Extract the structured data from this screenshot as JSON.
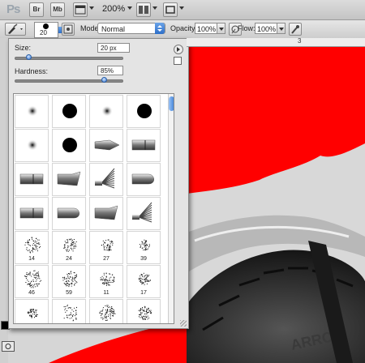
{
  "app": {
    "logo": "Ps",
    "bridge_label": "Br",
    "minibridge_label": "Mb",
    "zoom": "200%"
  },
  "options": {
    "brush_size": "20",
    "mode_label": "Mode:",
    "mode_value": "Normal",
    "opacity_label": "Opacity:",
    "opacity_value": "100%",
    "flow_label": "Flow:",
    "flow_value": "100%"
  },
  "ruler": {
    "mark": "3"
  },
  "brush_panel": {
    "size_label": "Size:",
    "size_value": "20 px",
    "size_level": 0.1,
    "hardness_label": "Hardness:",
    "hardness_value": "85%",
    "hardness_level": 0.85,
    "presets": [
      {
        "kind": "soft-round",
        "sz": ""
      },
      {
        "kind": "hard-round",
        "sz": ""
      },
      {
        "kind": "soft-round",
        "sz": ""
      },
      {
        "kind": "hard-round",
        "sz": ""
      },
      {
        "kind": "soft-round",
        "sz": ""
      },
      {
        "kind": "hard-round",
        "sz": ""
      },
      {
        "kind": "pointed-bristle",
        "sz": ""
      },
      {
        "kind": "flat-bristle",
        "sz": ""
      },
      {
        "kind": "flat-bristle",
        "sz": ""
      },
      {
        "kind": "angle-bristle",
        "sz": ""
      },
      {
        "kind": "fan-bristle",
        "sz": ""
      },
      {
        "kind": "round-bristle",
        "sz": ""
      },
      {
        "kind": "flat-bristle",
        "sz": ""
      },
      {
        "kind": "round-bristle",
        "sz": ""
      },
      {
        "kind": "angle-bristle",
        "sz": ""
      },
      {
        "kind": "fan-bristle",
        "sz": ""
      },
      {
        "kind": "spatter",
        "sz": "14"
      },
      {
        "kind": "spatter",
        "sz": "24"
      },
      {
        "kind": "spatter",
        "sz": "27"
      },
      {
        "kind": "spatter",
        "sz": "39"
      },
      {
        "kind": "spatter",
        "sz": "46"
      },
      {
        "kind": "spatter",
        "sz": "59"
      },
      {
        "kind": "spatter",
        "sz": "11"
      },
      {
        "kind": "spatter",
        "sz": "17"
      },
      {
        "kind": "spatter",
        "sz": ""
      },
      {
        "kind": "spatter",
        "sz": ""
      },
      {
        "kind": "spatter",
        "sz": ""
      },
      {
        "kind": "spatter",
        "sz": ""
      }
    ]
  },
  "colors": {
    "red": "#ff0000",
    "tire": "#2a2a2a",
    "accent": "#2d6fc9"
  }
}
